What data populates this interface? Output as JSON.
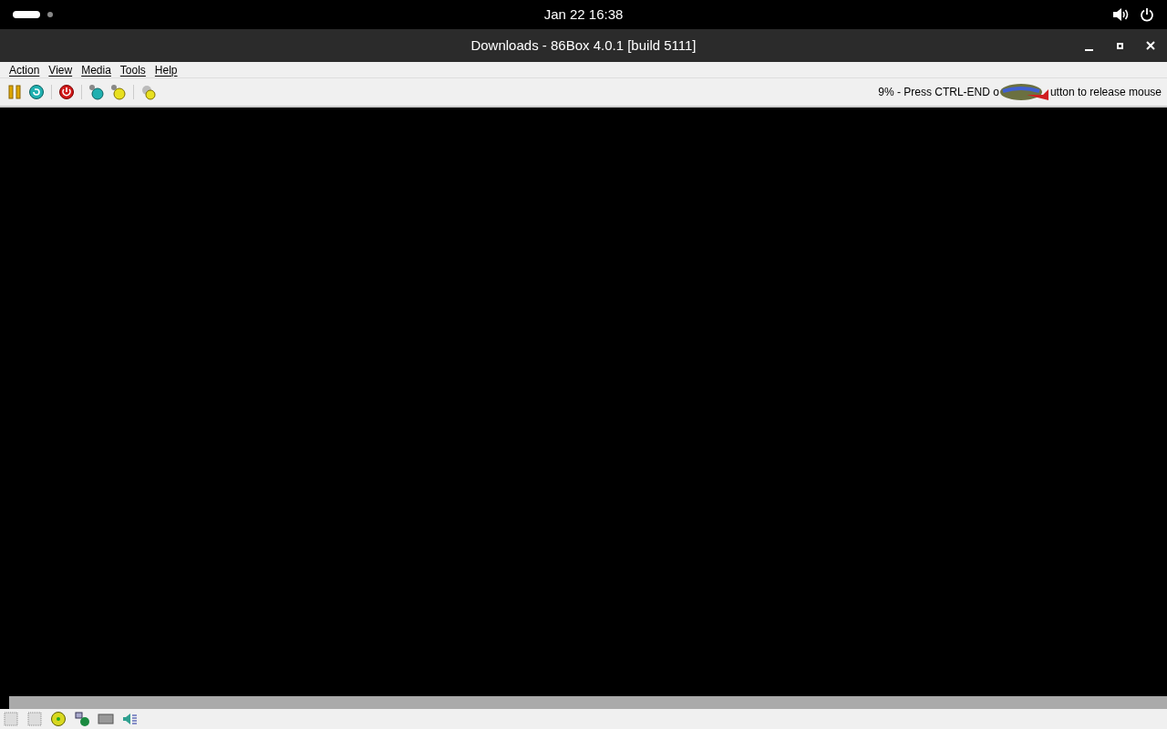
{
  "top_bar": {
    "clock": "Jan 22  16:38"
  },
  "window": {
    "title": "Downloads - 86Box 4.0.1 [build 5111]"
  },
  "menu": [
    "Action",
    "View",
    "Media",
    "Tools",
    "Help"
  ],
  "toolbar": {
    "status_before": "9% - Press CTRL-END o",
    "status_after": "utton to release mouse"
  }
}
